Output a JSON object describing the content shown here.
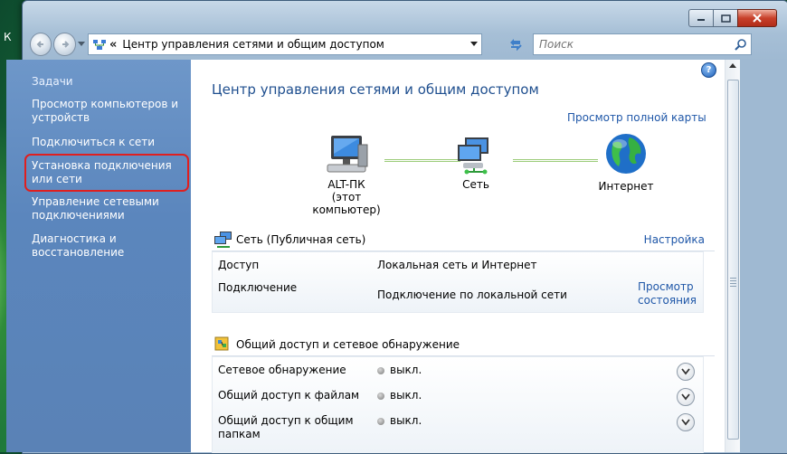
{
  "desktop": {
    "edge_letter": "К"
  },
  "window": {
    "address_path": "Центр управления сетями и общим доступом",
    "address_chevron": "«",
    "search_placeholder": "Поиск"
  },
  "sidebar": {
    "items": [
      "Задачи",
      "Просмотр компьютеров и устройств",
      "Подключиться к сети",
      "Установка подключения или сети",
      "Управление сетевыми подключениями",
      "Диагностика и восстановление"
    ]
  },
  "main": {
    "help_label": "?",
    "title": "Центр управления сетями и общим доступом",
    "full_map_link": "Просмотр полной карты",
    "map": {
      "computer_name": "ALT-ПК",
      "computer_sub": "(этот компьютер)",
      "network_label": "Сеть",
      "internet_label": "Интернет"
    },
    "network_section": {
      "title": "Сеть (Публичная сеть)",
      "configure_link": "Настройка",
      "rows": [
        {
          "label": "Доступ",
          "value": "Локальная сеть и Интернет"
        },
        {
          "label": "Подключение",
          "value": "Подключение по локальной сети",
          "link": "Просмотр состояния"
        }
      ]
    },
    "sharing_section": {
      "title": "Общий доступ и сетевое обнаружение",
      "rows": [
        {
          "label": "Сетевое обнаружение",
          "value": "выкл."
        },
        {
          "label": "Общий доступ к файлам",
          "value": "выкл."
        },
        {
          "label": "Общий доступ к общим папкам",
          "value": "выкл."
        }
      ]
    }
  },
  "colors": {
    "link": "#1f57a8",
    "title": "#1f4f8f",
    "sidebar": "#5b86bd",
    "highlight": "#e01f1f"
  }
}
